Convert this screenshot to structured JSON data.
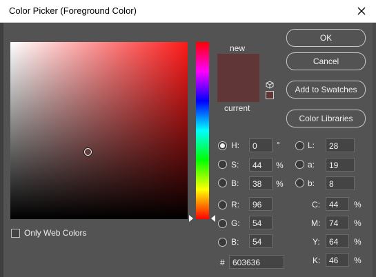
{
  "window": {
    "title": "Color Picker (Foreground Color)"
  },
  "preview": {
    "new_label": "new",
    "current_label": "current",
    "color": "#603636"
  },
  "buttons": {
    "ok": "OK",
    "cancel": "Cancel",
    "add_to_swatches": "Add to Swatches",
    "color_libraries": "Color Libraries"
  },
  "checkbox": {
    "only_web_colors": "Only Web Colors",
    "checked": false
  },
  "hsb": {
    "h_label": "H:",
    "h_value": "0",
    "h_unit": "°",
    "s_label": "S:",
    "s_value": "44",
    "s_unit": "%",
    "b_label": "B:",
    "b_value": "38",
    "b_unit": "%"
  },
  "lab": {
    "l_label": "L:",
    "l_value": "28",
    "a_label": "a:",
    "a_value": "19",
    "b_label": "b:",
    "b_value": "8"
  },
  "rgb": {
    "r_label": "R:",
    "r_value": "96",
    "g_label": "G:",
    "g_value": "54",
    "b_label": "B:",
    "b_value": "54"
  },
  "cmyk": {
    "c_label": "C:",
    "c_value": "44",
    "c_unit": "%",
    "m_label": "M:",
    "m_value": "74",
    "m_unit": "%",
    "y_label": "Y:",
    "y_value": "64",
    "y_unit": "%",
    "k_label": "K:",
    "k_value": "46",
    "k_unit": "%"
  },
  "hex": {
    "label": "#",
    "value": "603636"
  },
  "selected_mode": "H",
  "icons": {
    "close": "close-icon",
    "cube": "out-of-gamut-cube-icon"
  }
}
